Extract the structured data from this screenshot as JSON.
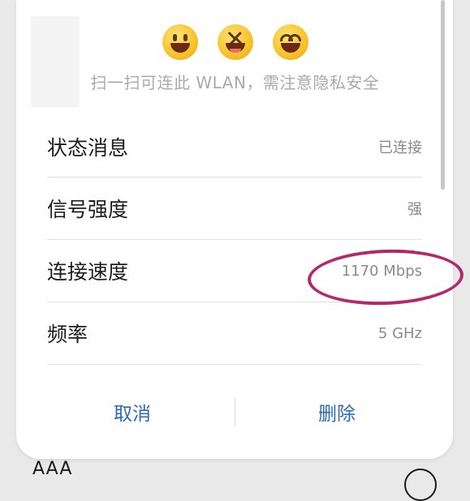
{
  "backdrop": {
    "text": "AAA"
  },
  "header": {
    "emojis": [
      "grinning-face",
      "squinting-laughing-face",
      "smiling-face-open-mouth"
    ],
    "notice": "扫一扫可连此 WLAN，需注意隐私安全"
  },
  "details": [
    {
      "label": "状态消息",
      "value": "已连接"
    },
    {
      "label": "信号强度",
      "value": "强"
    },
    {
      "label": "连接速度",
      "value": "1170 Mbps"
    },
    {
      "label": "频率",
      "value": "5 GHz"
    }
  ],
  "buttons": {
    "cancel": "取消",
    "delete": "删除"
  },
  "colors": {
    "accent": "#2a6ab8",
    "highlight": "#b3286a"
  }
}
